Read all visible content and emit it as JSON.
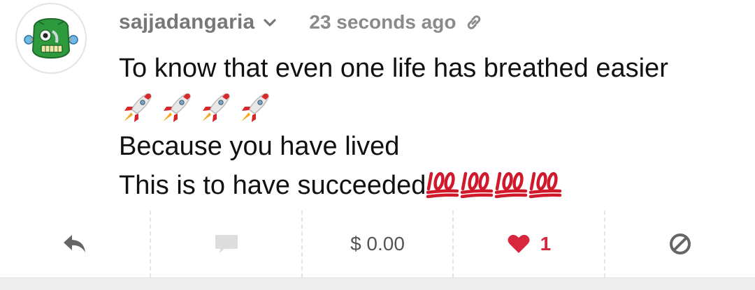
{
  "post": {
    "author": "sajjadangaria",
    "timestamp": "23 seconds ago",
    "lines": [
      "To know that even one life has breathed easier",
      "Because you have lived",
      "This is to have succeeded"
    ]
  },
  "icons": {
    "avatar": "green-robot-avatar",
    "author_menu": "chevron-down-icon",
    "permalink": "link-icon",
    "rocket_emoji": "rocket-emoji",
    "hundred_emoji": "hundred-points-emoji",
    "reply": "reply-icon",
    "comment": "comment-icon",
    "vote": "heart-icon",
    "flag": "flag-ban-icon"
  },
  "actions": {
    "payout": "$ 0.00",
    "vote_count": "1"
  },
  "colors": {
    "username": "#777777",
    "vote_red": "#d7263d",
    "icon_grey": "#666666",
    "comment_grey": "#dddddd",
    "avatar_green": "#2e9a3e"
  }
}
